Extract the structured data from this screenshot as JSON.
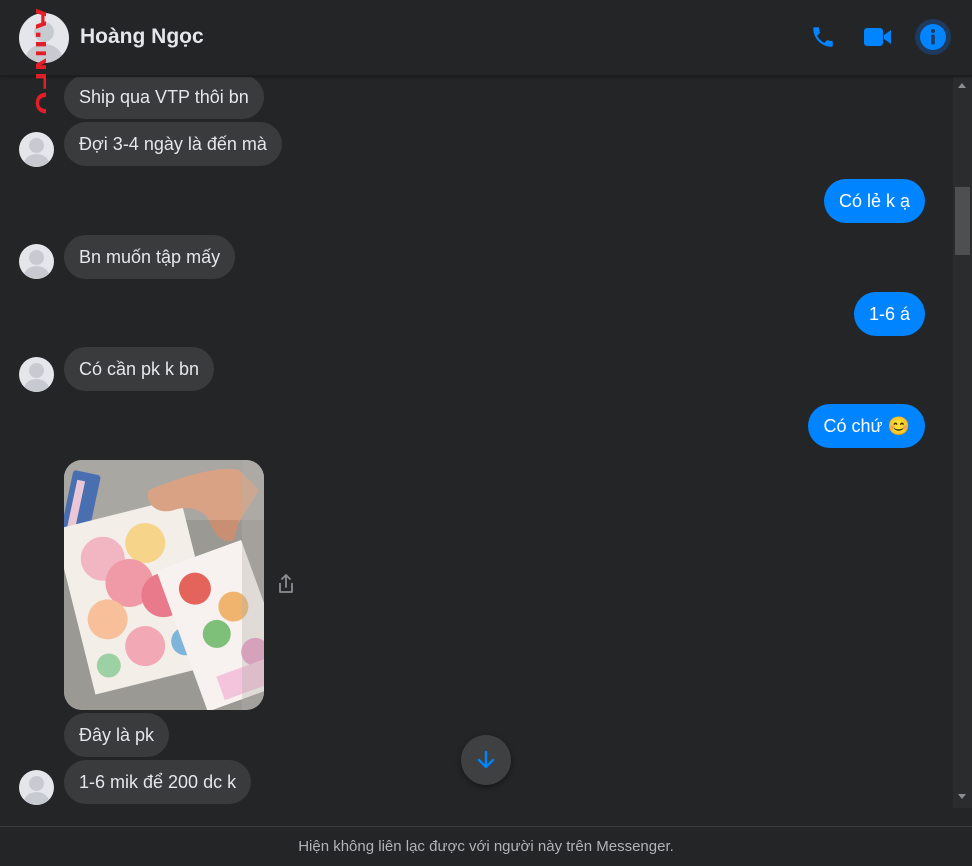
{
  "header": {
    "contact_name": "Hoàng Ngọc",
    "watermark": "A.INFO",
    "icons": [
      "phone-icon",
      "video-camera-icon",
      "info-icon"
    ]
  },
  "messages": [
    {
      "from": "them",
      "text": "Ship qua VTP thôi bn"
    },
    {
      "from": "them",
      "text": "Đợi 3-4 ngày là đến mà"
    },
    {
      "from": "me",
      "text": "Có lẻ k ạ"
    },
    {
      "from": "them",
      "text": "Bn muốn tập mấy"
    },
    {
      "from": "me",
      "text": "1-6 á"
    },
    {
      "from": "them",
      "text": "Có cần pk k bn"
    },
    {
      "from": "me",
      "text": "Có chứ",
      "emoji": "😊"
    },
    {
      "from": "them",
      "type": "photo"
    },
    {
      "from": "them",
      "text": "Đây là pk"
    },
    {
      "from": "them",
      "text": "1-6 mik để 200 dc k"
    }
  ],
  "footer": {
    "notice": "Hiện không liên lạc được với người này trên Messenger."
  },
  "colors": {
    "background": "#242526",
    "incoming_bubble": "#3a3b3c",
    "outgoing_bubble": "#0084ff",
    "accent": "#0084ff",
    "watermark": "#e41e26"
  }
}
